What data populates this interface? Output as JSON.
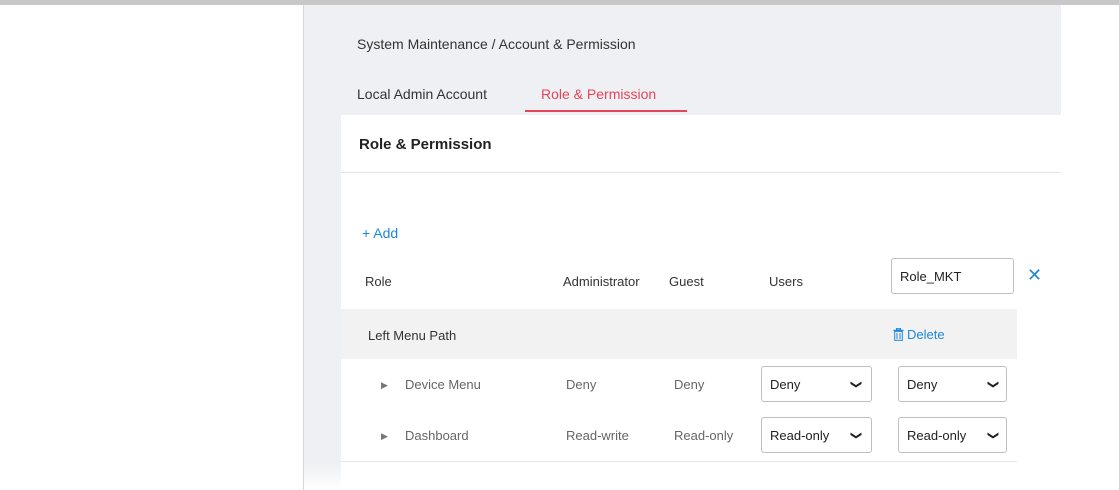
{
  "breadcrumb": "System Maintenance / Account & Permission",
  "tabs": [
    {
      "label": "Local Admin Account",
      "active": false
    },
    {
      "label": "Role & Permission",
      "active": true
    }
  ],
  "panel": {
    "title": "Role & Permission",
    "add_label": "+ Add",
    "columns": [
      "Role",
      "Administrator",
      "Guest",
      "Users"
    ],
    "new_role_value": "Role_MKT",
    "close_icon": "close-icon",
    "group_label": "Left Menu Path",
    "delete_label": "Delete",
    "delete_icon": "trash-icon",
    "rows": [
      {
        "name": "Device Menu",
        "administrator": "Deny",
        "guest": "Deny",
        "users": "Deny",
        "new_role": "Deny"
      },
      {
        "name": "Dashboard",
        "administrator": "Read-write",
        "guest": "Read-only",
        "users": "Read-only",
        "new_role": "Read-only"
      }
    ]
  },
  "colors": {
    "accent": "#e5455b",
    "link": "#1e88d6"
  }
}
